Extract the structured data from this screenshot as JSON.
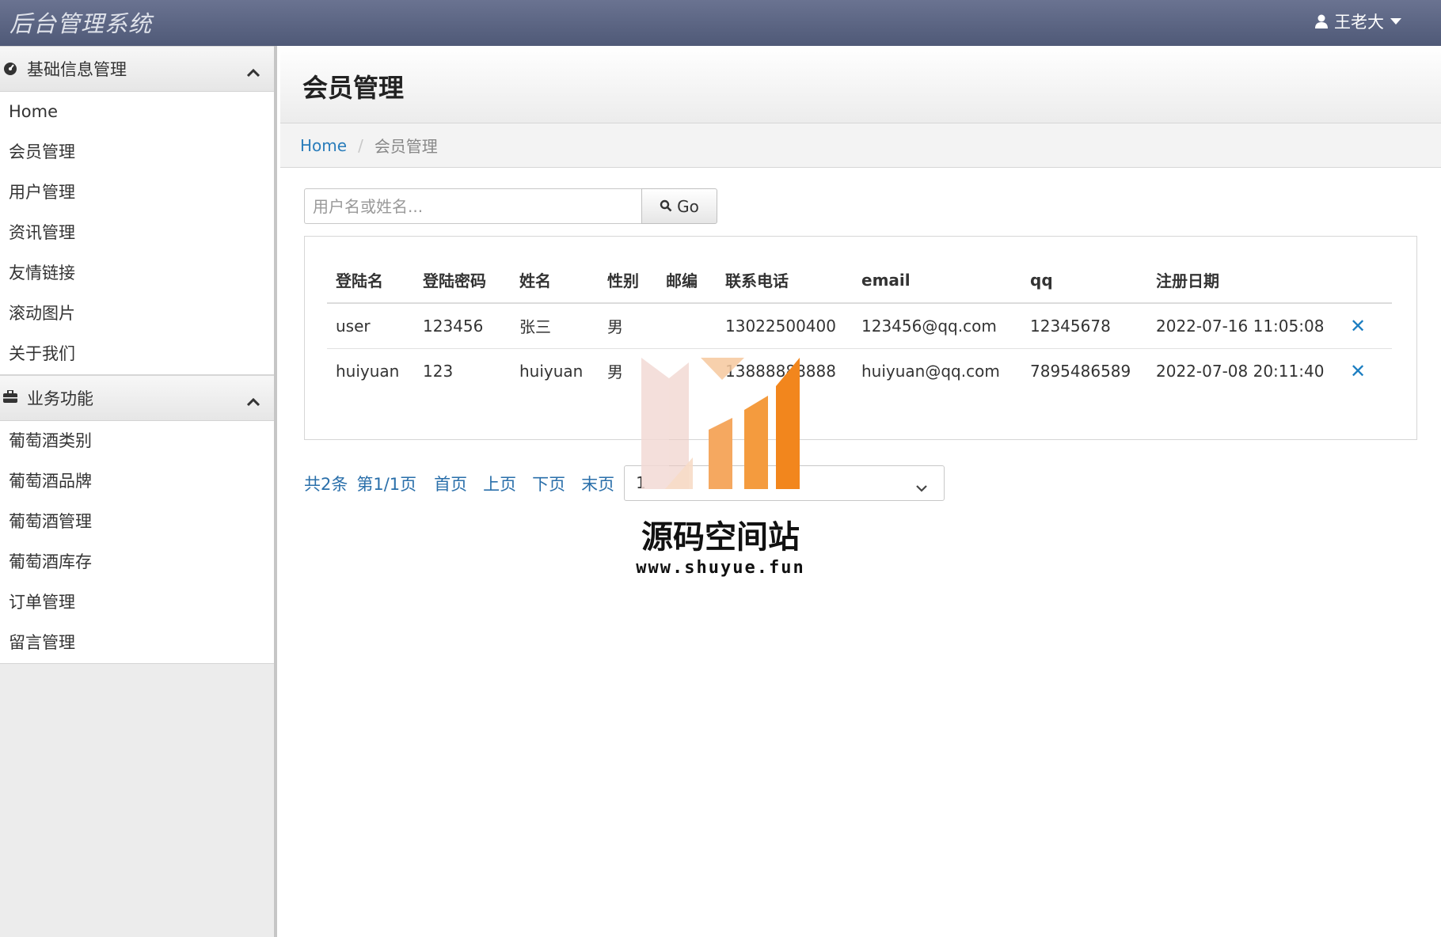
{
  "app": {
    "title": "后台管理系统",
    "user": "王老大"
  },
  "sidebar": {
    "sections": [
      {
        "title": "基础信息管理",
        "items": [
          "Home",
          "会员管理",
          "用户管理",
          "资讯管理",
          "友情链接",
          "滚动图片",
          "关于我们"
        ]
      },
      {
        "title": "业务功能",
        "items": [
          "葡萄酒类别",
          "葡萄酒品牌",
          "葡萄酒管理",
          "葡萄酒库存",
          "订单管理",
          "留言管理"
        ]
      }
    ]
  },
  "page": {
    "title": "会员管理",
    "breadcrumb": {
      "home": "Home",
      "current": "会员管理"
    }
  },
  "search": {
    "placeholder": "用户名或姓名...",
    "button": "Go"
  },
  "table": {
    "columns": [
      "登陆名",
      "登陆密码",
      "姓名",
      "性别",
      "邮编",
      "联系电话",
      "email",
      "qq",
      "注册日期"
    ],
    "rows": [
      [
        "user",
        "123456",
        "张三",
        "男",
        "",
        "13022500400",
        "123456@qq.com",
        "12345678",
        "2022-07-16 11:05:08"
      ],
      [
        "huiyuan",
        "123",
        "huiyuan",
        "男",
        "",
        "13888888888",
        "huiyuan@qq.com",
        "7895486589",
        "2022-07-08 20:11:40"
      ]
    ],
    "delete_symbol": "✕"
  },
  "pager": {
    "total": "共2条",
    "page_info": "第1/1页",
    "first": "首页",
    "prev": "上页",
    "next": "下页",
    "last": "末页",
    "selected": "1"
  },
  "watermark": {
    "text": "源码空间站",
    "url": "www.shuyue.fun"
  }
}
